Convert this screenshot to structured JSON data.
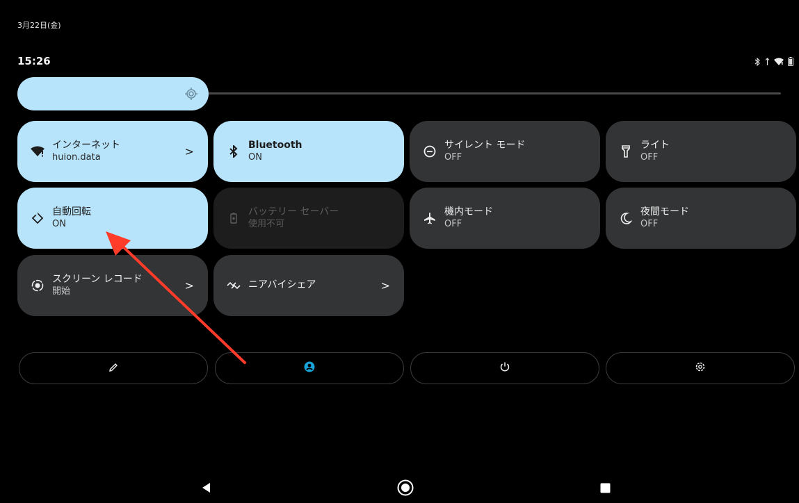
{
  "status": {
    "date": "3月22日(金)",
    "time": "15:26"
  },
  "brightness": {
    "level": 0.25
  },
  "tiles": [
    {
      "label": "インターネット",
      "sub": "huion.data",
      "state": "on",
      "icon": "wifi-icon",
      "chevron": ">"
    },
    {
      "label": "Bluetooth",
      "sub": "ON",
      "state": "on",
      "icon": "bluetooth-icon",
      "chevron": ""
    },
    {
      "label": "サイレント モード",
      "sub": "OFF",
      "state": "off",
      "icon": "do-not-disturb-icon",
      "chevron": ""
    },
    {
      "label": "ライト",
      "sub": "OFF",
      "state": "off",
      "icon": "flashlight-icon",
      "chevron": ""
    },
    {
      "label": "自動回転",
      "sub": "ON",
      "state": "on",
      "icon": "auto-rotate-icon",
      "chevron": ""
    },
    {
      "label": "バッテリー セーバー",
      "sub": "使用不可",
      "state": "disabled",
      "icon": "battery-saver-icon",
      "chevron": ""
    },
    {
      "label": "機内モード",
      "sub": "OFF",
      "state": "off",
      "icon": "airplane-icon",
      "chevron": ""
    },
    {
      "label": "夜間モード",
      "sub": "OFF",
      "state": "off",
      "icon": "night-mode-icon",
      "chevron": ""
    },
    {
      "label": "スクリーン レコード",
      "sub": "開始",
      "state": "off",
      "icon": "screen-record-icon",
      "chevron": ">"
    },
    {
      "label": "ニアバイシェア",
      "sub": "",
      "state": "off",
      "icon": "nearby-share-icon",
      "chevron": ">"
    }
  ],
  "colors": {
    "tile_on": "#b8e4fb",
    "tile_off": "#333436",
    "accent": "#1aa3d9"
  }
}
